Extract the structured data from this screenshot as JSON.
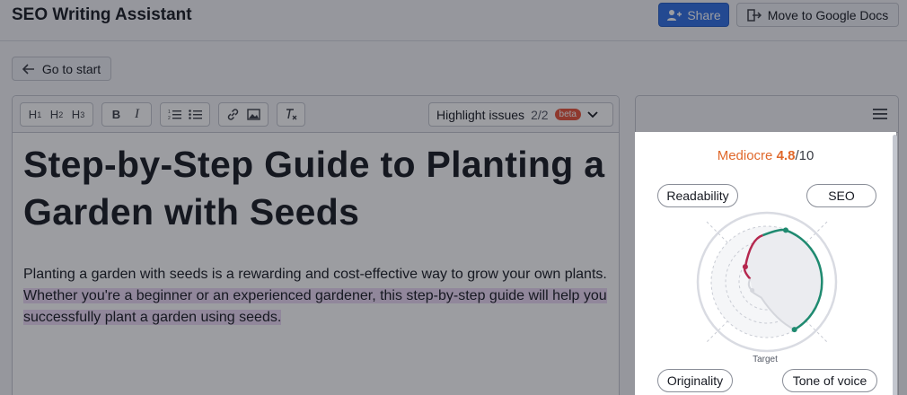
{
  "header": {
    "title": "SEO Writing Assistant",
    "share_label": "Share",
    "gdocs_label": "Move to Google Docs"
  },
  "nav": {
    "start_label": "Go to start"
  },
  "toolbar": {
    "heading_buttons": [
      "H1",
      "H2",
      "H3"
    ],
    "format_buttons": [
      "B",
      "I"
    ],
    "highlight": {
      "label": "Highlight issues",
      "count": "2/2",
      "badge": "beta"
    }
  },
  "document": {
    "title": "Step-by-Step Guide to Planting a Garden with Seeds",
    "para_plain": "Planting a garden with seeds is a rewarding and cost-effective way to grow your own plants. ",
    "para_highlighted": "Whether you're a beginner or an experienced gardener, this step-by-step guide will help you successfully plant a garden using seeds."
  },
  "panel": {
    "score_label": "Mediocre",
    "score_value": "4.8",
    "score_max": "/10",
    "metrics": [
      "Readability",
      "SEO",
      "Originality",
      "Tone of voice"
    ],
    "target_label": "Target",
    "colors": {
      "accent": "#e0682b",
      "seo_line": "#1f8a70",
      "readability_line": "#b5284f",
      "share": "#2f6fe4"
    },
    "levels": {
      "readability": 0.3,
      "seo": 0.85,
      "originality": 0.05,
      "tone_of_voice": 0.85
    }
  }
}
